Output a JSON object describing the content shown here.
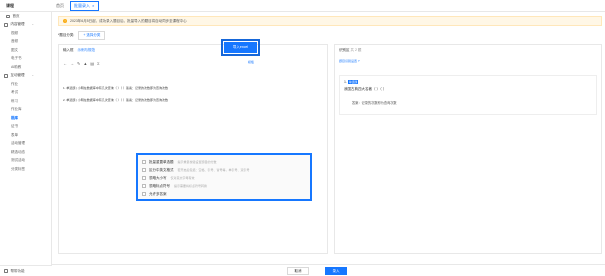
{
  "topbar": {
    "brand": "课程",
    "tabs": [
      {
        "label": "首页"
      },
      {
        "label": "批量录入"
      }
    ]
  },
  "sidebar": {
    "items": [
      {
        "label": "首页",
        "type": "item"
      },
      {
        "label": "内容管理",
        "type": "group",
        "caret": "^"
      },
      {
        "label": "视频",
        "type": "sub"
      },
      {
        "label": "音频",
        "type": "sub"
      },
      {
        "label": "图文",
        "type": "sub"
      },
      {
        "label": "电子书",
        "type": "sub"
      },
      {
        "label": "AI助教",
        "type": "sub"
      },
      {
        "label": "互动管理",
        "type": "group",
        "caret": "^"
      },
      {
        "label": "作业",
        "type": "sub"
      },
      {
        "label": "考试",
        "type": "sub"
      },
      {
        "label": "练习",
        "type": "sub"
      },
      {
        "label": "作业库",
        "type": "sub"
      },
      {
        "label": "题库",
        "type": "sub",
        "active": true
      },
      {
        "label": "证书",
        "type": "sub"
      },
      {
        "label": "表单",
        "type": "sub"
      },
      {
        "label": "活动管理",
        "type": "sub"
      },
      {
        "label": "精选动态",
        "type": "sub"
      },
      {
        "label": "测试活动",
        "type": "sub"
      },
      {
        "label": "分类标签",
        "type": "sub"
      }
    ],
    "footer": "帮带功能"
  },
  "notice": {
    "text": "2023年6月5日起，成功录入题目后，批量导入的题目将自动同步至课程中心"
  },
  "category": {
    "label": "*题目分类:",
    "button": "+ 选择分类"
  },
  "left_panel": {
    "title": "输入框",
    "link": "示例与规范",
    "import_button": "导入excel",
    "template_link": "模板",
    "toolbar": [
      "←",
      "→",
      "✎",
      "▲",
      "▤",
      "Σ"
    ],
    "lines": [
      "1. 单选题 | 小明在数据库中有几次查询（ ）（ ）答案：记录的次数即为查询次数",
      "2. 单选题 | 小明在数据库中有几次查询（ ）（ ）答案：记录的次数即为查询次数"
    ]
  },
  "right_panel": {
    "title": "识别区",
    "count": "共 2 题",
    "link": "题目识别设置 ?",
    "question": {
      "num": "1.",
      "tag": "单选题",
      "title": "我国古典四大名著（ ）（ ）",
      "answer": "答案：记录的次数即为查询次数"
    },
    "options": [
      {
        "label": "批量重置单选题",
        "hint": "提示重复校验设置题目的分数"
      },
      {
        "label": "区分中英文格式",
        "hint": "若开启后包括：空格、引号、冒号等，单引号、双引号"
      },
      {
        "label": "忽略大小写",
        "hint": "仅对英文字母有效"
      },
      {
        "label": "忽略标点符号",
        "hint": "提示需要将标点符号转换"
      },
      {
        "label": "允许多答案",
        "hint": ""
      }
    ]
  },
  "footer": {
    "cancel": "取消",
    "submit": "录入"
  }
}
